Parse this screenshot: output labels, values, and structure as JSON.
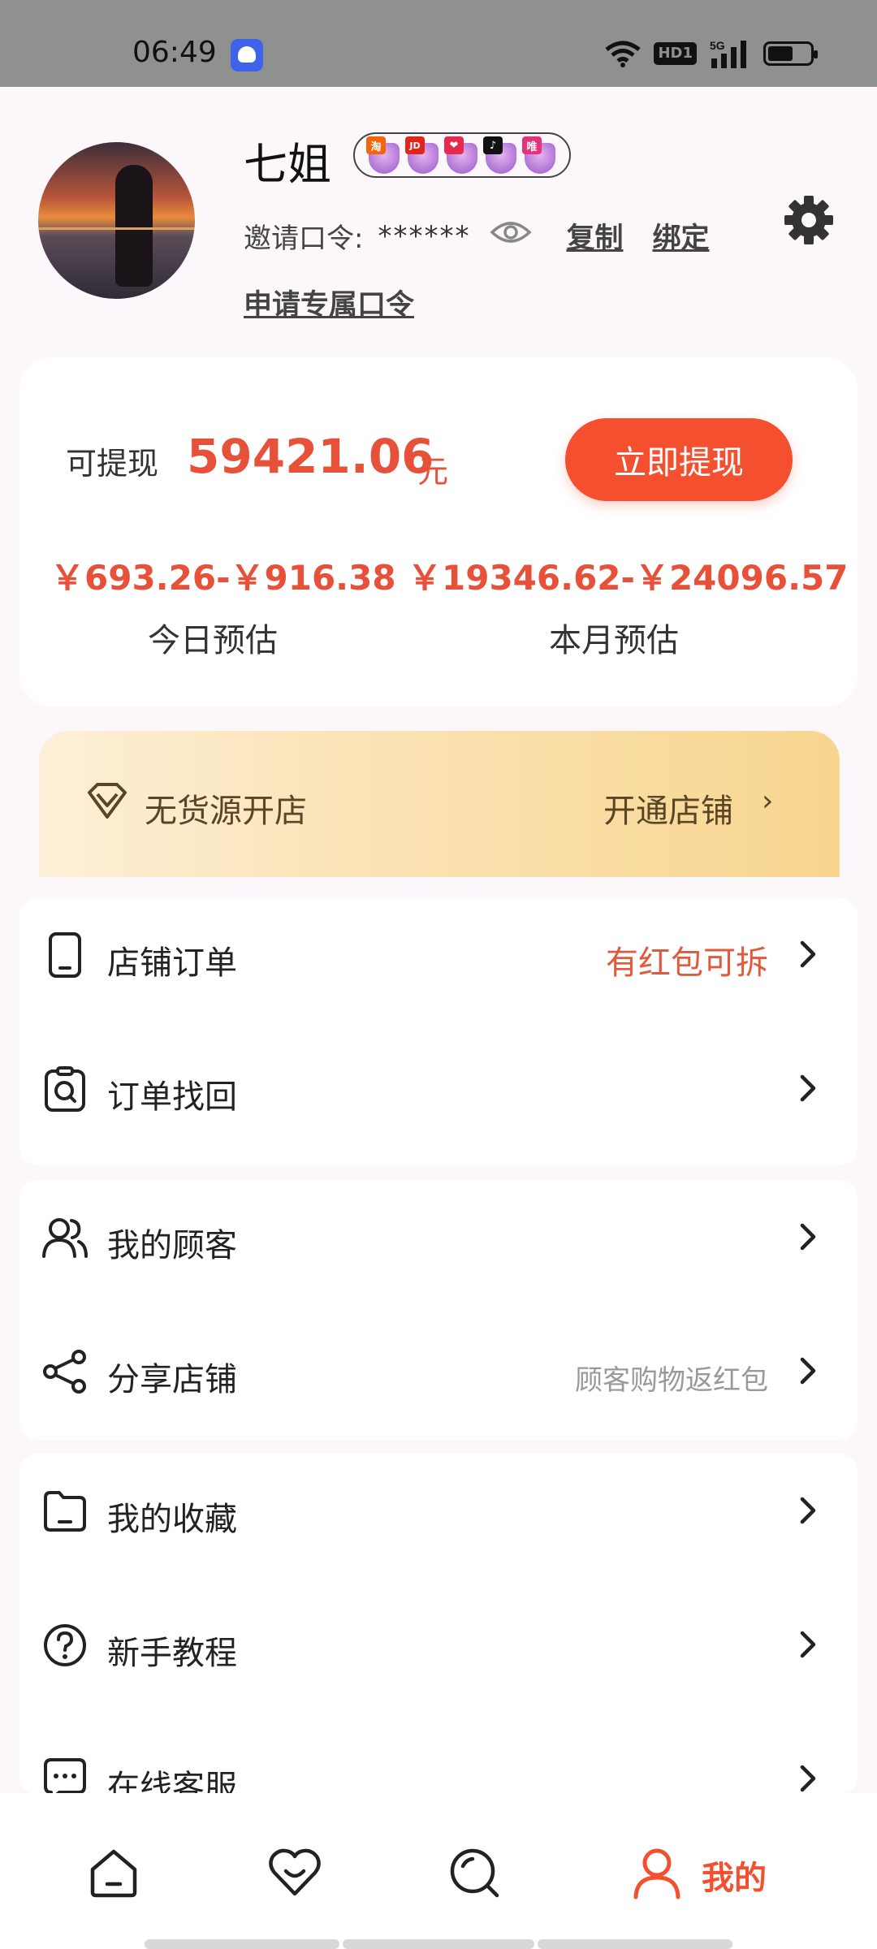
{
  "status_bar": {
    "time": "06:49",
    "hd_label": "HD1",
    "network": "5G"
  },
  "profile": {
    "name": "七姐",
    "badges": [
      {
        "tag": "淘",
        "color": "#f5640a"
      },
      {
        "tag": "JD",
        "color": "#e1251b"
      },
      {
        "tag": "❤",
        "color": "#e6294d"
      },
      {
        "tag": "♪",
        "color": "#111111"
      },
      {
        "tag": "唯",
        "color": "#e5337a"
      }
    ],
    "invite_label": "邀请口令:",
    "invite_code": "******",
    "copy_label": "复制",
    "bind_label": "绑定",
    "apply_label": "申请专属口令"
  },
  "earnings": {
    "withdraw_label": "可提现",
    "withdraw_amount": "59421.06",
    "withdraw_unit": "元",
    "withdraw_button": "立即提现",
    "today_value": "￥693.26-￥916.38",
    "today_label": "今日预估",
    "month_value": "￥19346.62-￥24096.57",
    "month_label": "本月预估"
  },
  "shop_banner": {
    "title": "无货源开店",
    "action": "开通店铺"
  },
  "menu": {
    "store_orders": {
      "label": "店铺订单",
      "hint": "有红包可拆"
    },
    "order_recover": {
      "label": "订单找回"
    },
    "my_customers": {
      "label": "我的顾客"
    },
    "share_store": {
      "label": "分享店铺",
      "hint": "顾客购物返红包"
    },
    "favorites": {
      "label": "我的收藏"
    },
    "tutorial": {
      "label": "新手教程"
    },
    "support": {
      "label": "在线客服"
    }
  },
  "bottom_nav": {
    "active_label": "我的"
  },
  "colors": {
    "accent": "#f4502f",
    "amount": "#e7513a",
    "banner_text": "#5a4526"
  }
}
